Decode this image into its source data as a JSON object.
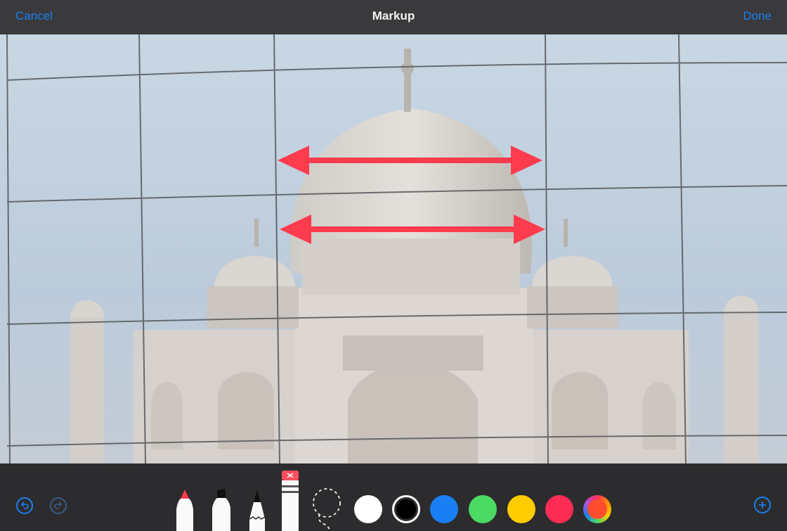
{
  "header": {
    "cancel_label": "Cancel",
    "title": "Markup",
    "done_label": "Done"
  },
  "toolbar": {
    "undo_icon": "undo-icon",
    "redo_icon": "redo-icon",
    "add_icon": "plus-icon",
    "tools": [
      "pen",
      "marker",
      "pencil",
      "eraser",
      "lasso"
    ],
    "colors": [
      "#ffffff",
      "#000000",
      "#1a7ff2",
      "#4cd964",
      "#ffcc00",
      "#ff2d55",
      "color-wheel"
    ],
    "selected_color": "#000000",
    "accent": "#1a7ff2"
  },
  "annotations": {
    "arrow_color": "#ff3b4e",
    "count": "2"
  }
}
